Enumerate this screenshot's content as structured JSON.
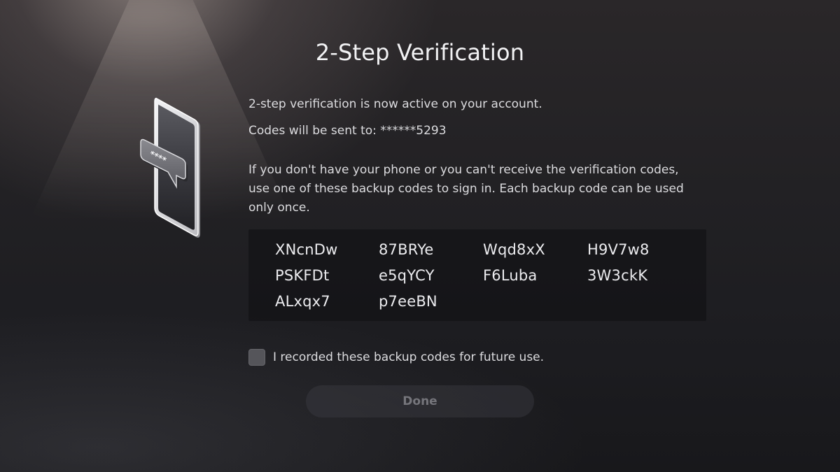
{
  "header": {
    "title": "2-Step Verification"
  },
  "info": {
    "active_message": "2-step verification is now active on your account.",
    "sent_to": "Codes will be sent to: ******5293",
    "backup_instructions": "If you don't have your phone or you can't receive the verification codes, use one of these backup codes to sign in. Each backup code can be used only once."
  },
  "backup_codes": [
    "XNcnDw",
    "87BRYe",
    "Wqd8xX",
    "H9V7w8",
    "PSKFDt",
    "e5qYCY",
    "F6Luba",
    "3W3ckK",
    "ALxqx7",
    "p7eeBN"
  ],
  "illustration": {
    "icon": "phone-password-icon",
    "masked_text": "****"
  },
  "confirmation": {
    "checkbox_label": "I recorded these backup codes for future use.",
    "checked": false
  },
  "actions": {
    "done_label": "Done"
  },
  "colors": {
    "background": "#1c1c20",
    "codes_panel": "#0e0e12",
    "checkbox": "#55555a",
    "button_disabled_text": "#75757b"
  }
}
